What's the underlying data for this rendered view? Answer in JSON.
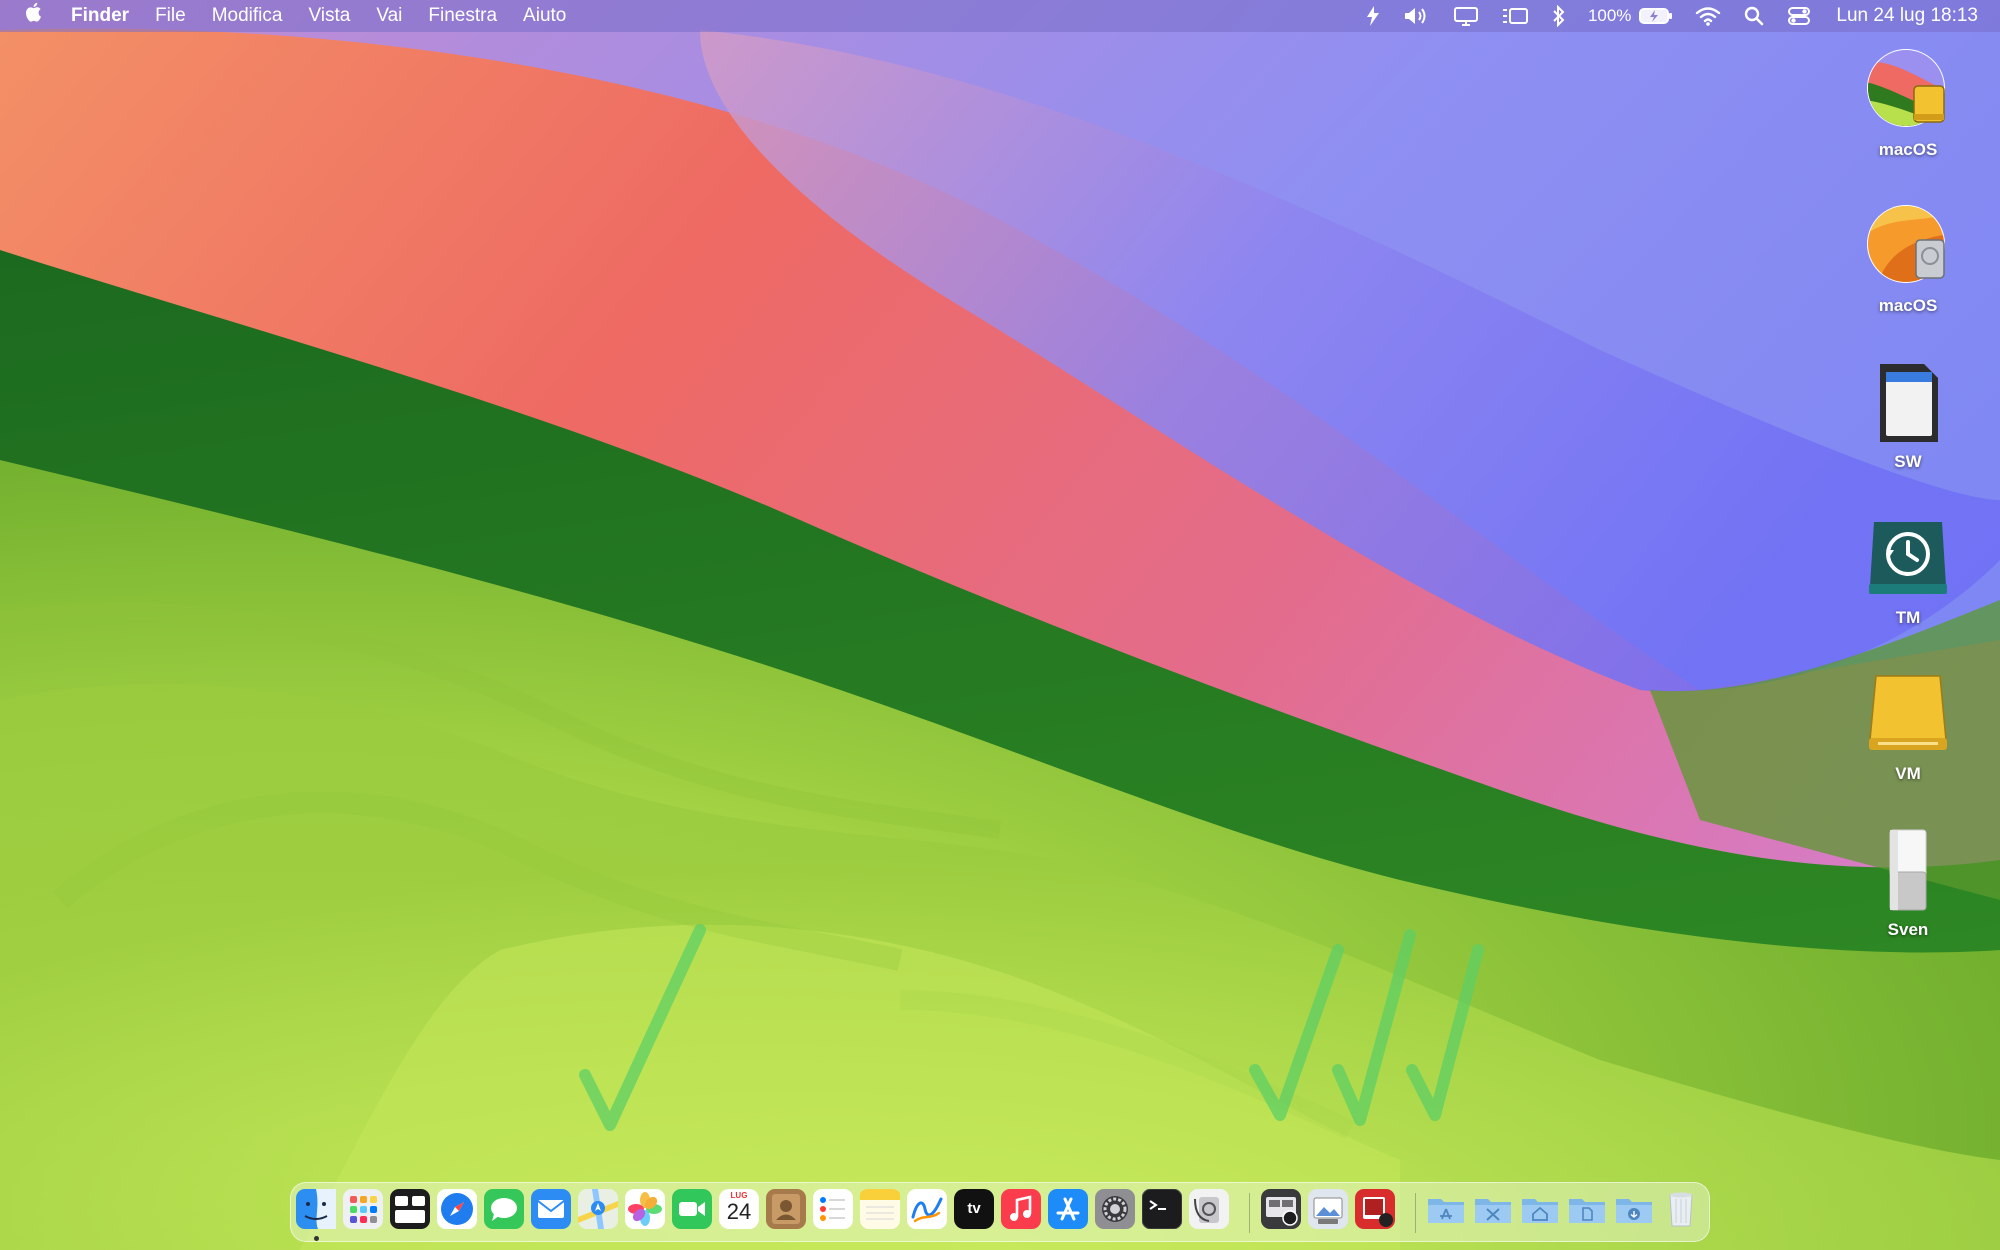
{
  "menubar": {
    "app_name": "Finder",
    "menus": [
      "File",
      "Modifica",
      "Vista",
      "Vai",
      "Finestra",
      "Aiuto"
    ],
    "battery_text": "100%",
    "clock": "Lun 24 lug  18:13"
  },
  "desktop_icons": [
    {
      "label": "macOS",
      "icon": "sonoma-disk-icon"
    },
    {
      "label": "macOS",
      "icon": "ventura-disk-icon"
    },
    {
      "label": "SW",
      "icon": "sd-card-icon"
    },
    {
      "label": "TM",
      "icon": "time-machine-disk-icon"
    },
    {
      "label": "VM",
      "icon": "external-drive-icon"
    },
    {
      "label": "Sven",
      "icon": "network-drive-icon"
    }
  ],
  "dock": {
    "calendar_month": "LUG",
    "calendar_day": "24",
    "tv_label": "tv",
    "apps": [
      "Finder",
      "Launchpad",
      "Mission Control",
      "Safari",
      "Messaggi",
      "Mail",
      "Mappe",
      "Foto",
      "FaceTime",
      "Calendario",
      "Contatti",
      "Promemoria",
      "Note",
      "Freeform",
      "TV",
      "Musica",
      "App Store",
      "Impostazioni di Sistema",
      "Terminale",
      "Utility Disco",
      "Acquisizione Immagine",
      "Anteprima",
      "Photo Booth",
      "Applicazioni",
      "Utility",
      "Home",
      "Documenti",
      "Download",
      "Cestino"
    ]
  },
  "colors": {
    "wallpaper_green": "#2f7a1e",
    "wallpaper_lime": "#b9e04f",
    "wallpaper_red": "#ee6a5c",
    "wallpaper_violet": "#7d7cf0",
    "menubar": "#8a7fd8",
    "check_marks": "#5fcf64"
  }
}
